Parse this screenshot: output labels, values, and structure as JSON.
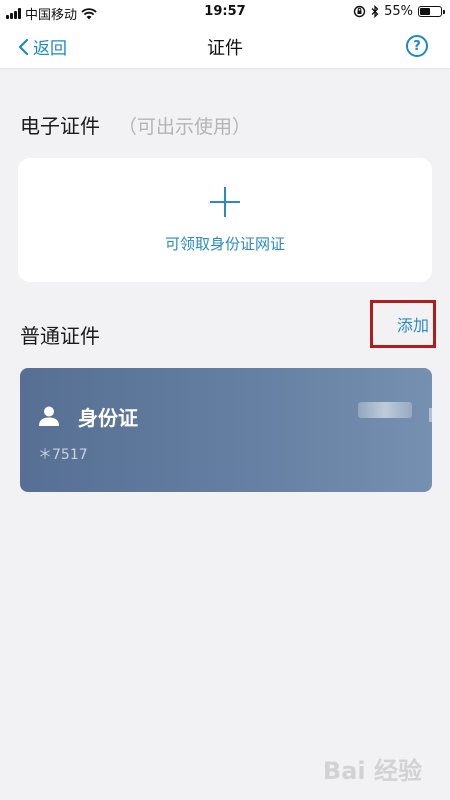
{
  "status_bar": {
    "carrier": "中国移动",
    "time": "19:57",
    "battery": "55%",
    "battery_level": 0.55
  },
  "nav": {
    "back_label": "返回",
    "title": "证件",
    "help_label": "?"
  },
  "electronic_section": {
    "title": "电子证件",
    "subtitle": "（可出示使用）",
    "card_label": "可领取身份证网证"
  },
  "normal_section": {
    "title": "普通证件",
    "add_label": "添加"
  },
  "id_card": {
    "title": "身份证",
    "number": "＊7517"
  },
  "watermark": "Bai 经验",
  "colors": {
    "accent": "#2a8ac4",
    "card_bg": "#5f7a9e",
    "highlight_border": "#b01d1d"
  }
}
